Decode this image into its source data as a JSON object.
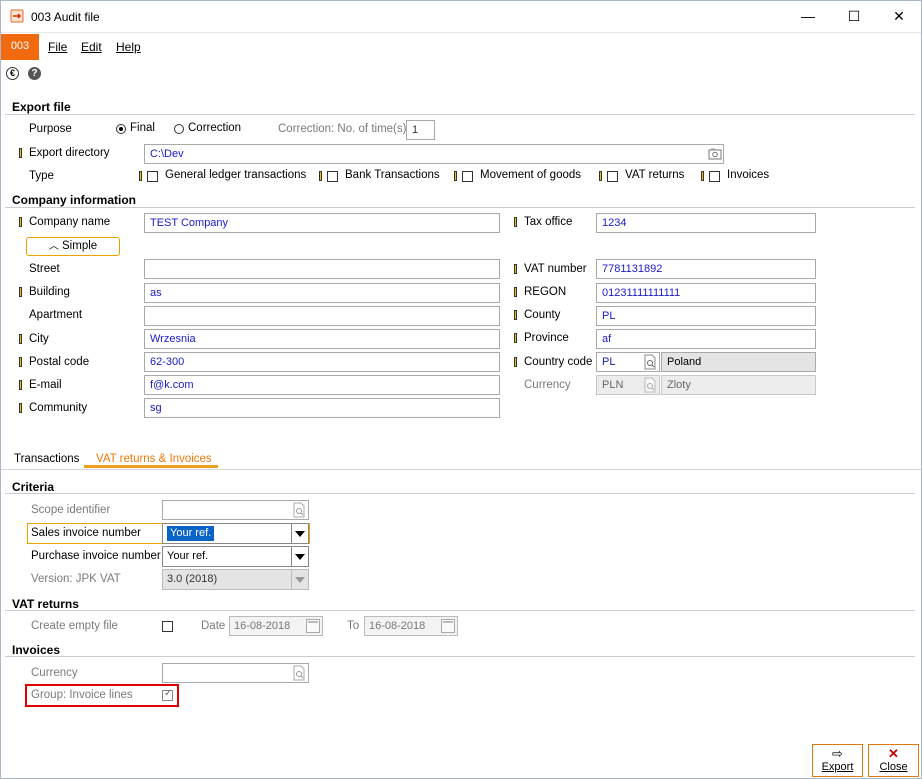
{
  "window": {
    "title": "003 Audit file",
    "minimize": "—",
    "maximize": "☐",
    "close": "✕"
  },
  "menu": {
    "badge": "003",
    "items": [
      "File",
      "Edit",
      "Help"
    ]
  },
  "sections": {
    "export_file": "Export file",
    "company_info": "Company information",
    "criteria": "Criteria",
    "vat_returns": "VAT returns",
    "invoices": "Invoices"
  },
  "export": {
    "purpose_label": "Purpose",
    "purpose_options": [
      {
        "label": "Final",
        "selected": true
      },
      {
        "label": "Correction",
        "selected": false
      }
    ],
    "correction_label": "Correction: No. of time(s)",
    "correction_value": "1",
    "directory_label": "Export directory",
    "directory_value": "C:\\Dev",
    "type_label": "Type",
    "types": [
      {
        "label": "General ledger transactions",
        "checked": false
      },
      {
        "label": "Bank Transactions",
        "checked": false
      },
      {
        "label": "Movement of goods",
        "checked": false
      },
      {
        "label": "VAT returns",
        "checked": false
      },
      {
        "label": "Invoices",
        "checked": false
      }
    ]
  },
  "company": {
    "simple_button": "Simple",
    "left": [
      {
        "label": "Company name",
        "value": "TEST Company"
      },
      {
        "label": "Street",
        "value": ""
      },
      {
        "label": "Building",
        "value": "as"
      },
      {
        "label": "Apartment",
        "value": ""
      },
      {
        "label": "City",
        "value": "Wrzesnia"
      },
      {
        "label": "Postal code",
        "value": "62-300"
      },
      {
        "label": "E-mail",
        "value": "f@k.com"
      },
      {
        "label": "Community",
        "value": "sg"
      }
    ],
    "right": [
      {
        "label": "Tax office",
        "value": "1234"
      },
      {
        "label": "VAT number",
        "value": "7781131892"
      },
      {
        "label": "REGON",
        "value": "01231111111111"
      },
      {
        "label": "County",
        "value": "PL"
      },
      {
        "label": "Province",
        "value": "af"
      }
    ],
    "country_code_label": "Country code",
    "country_code": "PL",
    "country_name": "Poland",
    "currency_label": "Currency",
    "currency_code": "PLN",
    "currency_name": "Zloty"
  },
  "tabs": [
    {
      "label": "Transactions",
      "active": false
    },
    {
      "label": "VAT returns & Invoices",
      "active": true
    }
  ],
  "criteria": {
    "scope_label": "Scope identifier",
    "scope_value": "",
    "sales_label": "Sales invoice number",
    "sales_value": "Your ref.",
    "purchase_label": "Purchase invoice number",
    "purchase_value": "Your ref.",
    "version_label": "Version: JPK VAT",
    "version_value": "3.0 (2018)"
  },
  "vat": {
    "empty_label": "Create empty file",
    "empty_checked": false,
    "date_label": "Date",
    "date_value": "16-08-2018",
    "to_label": "To",
    "to_value": "16-08-2018"
  },
  "invoices": {
    "currency_label": "Currency",
    "currency_value": "",
    "group_label": "Group: Invoice lines",
    "group_checked": true
  },
  "footer": {
    "export_label": "Export",
    "close_label": "Close"
  },
  "colors": {
    "accent": "#f26a10",
    "field_text": "#1a1acc",
    "highlight_border": "#e00000",
    "tab_active": "#f0780a"
  }
}
